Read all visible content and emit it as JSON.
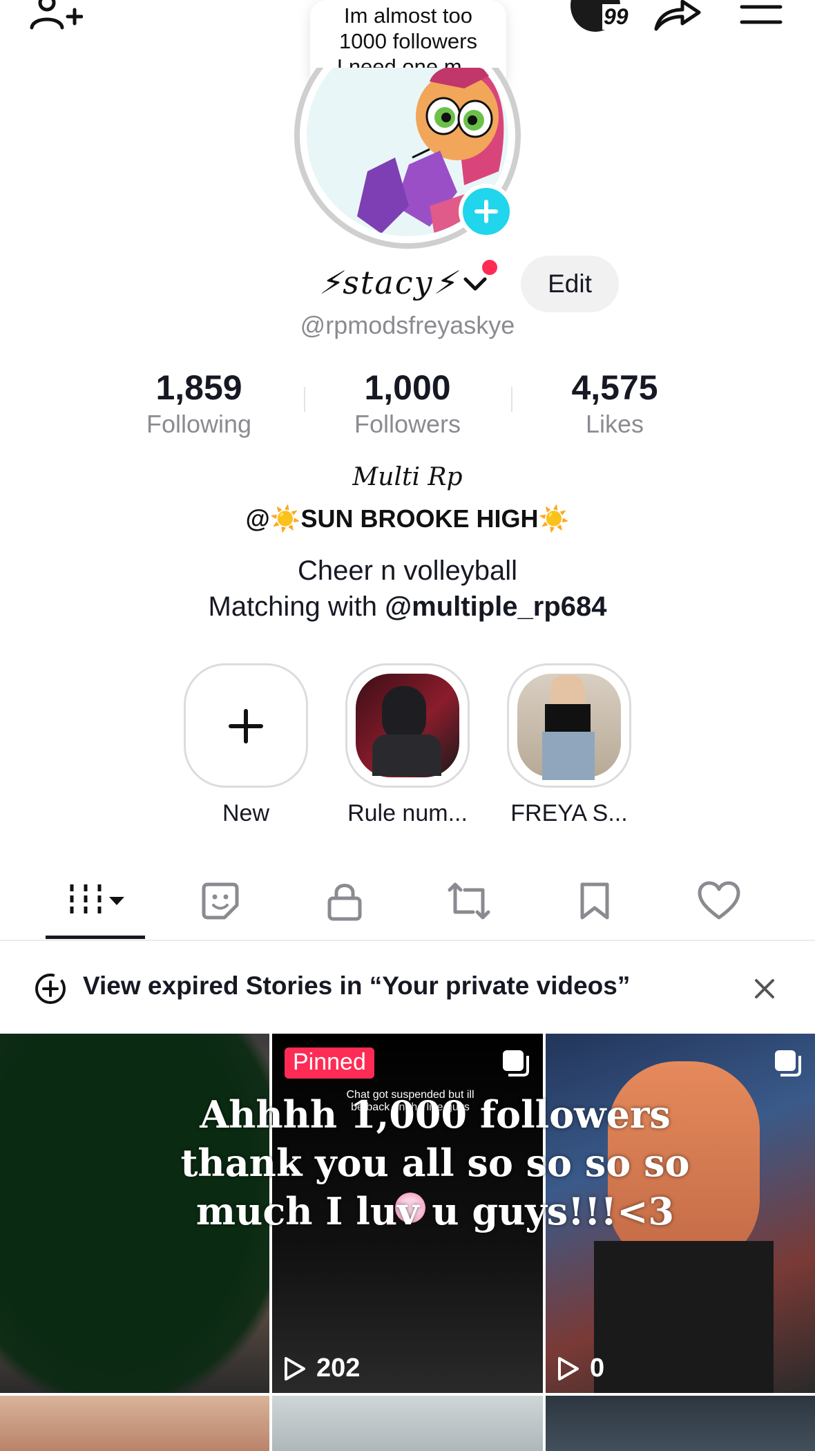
{
  "topbar": {
    "notification_count": "99"
  },
  "note": {
    "text_lines": [
      "Im almost too",
      "1000 followers",
      "I need one m..."
    ]
  },
  "profile": {
    "display_name": "⚡︎stacy⚡︎",
    "edit_label": "Edit",
    "handle": "@rpmodsfreyaskye"
  },
  "stats": {
    "following": {
      "value": "1,859",
      "label": "Following"
    },
    "followers": {
      "value": "1,000",
      "label": "Followers"
    },
    "likes": {
      "value": "4,575",
      "label": "Likes"
    }
  },
  "bio": {
    "line1": "Multi Rp",
    "line2": "@☀️SUN BROOKE HIGH☀️",
    "line3": "Cheer n volleyball",
    "line4_prefix": "Matching with ",
    "line4_mention": "@multiple_rp684"
  },
  "stories": [
    {
      "label": "New"
    },
    {
      "label": "Rule num..."
    },
    {
      "label": "FREYA S..."
    }
  ],
  "banner": {
    "text": "View expired Stories in “Your private videos”"
  },
  "videos": [
    {
      "pinned": false,
      "views": ""
    },
    {
      "pinned": true,
      "pinned_label": "Pinned",
      "views": "202",
      "caption": "Chat got suspended but ill be back on the live guys"
    },
    {
      "pinned": false,
      "views": "0"
    }
  ],
  "overlay": {
    "text": "Ahhhh 1,000 followers thank you all so so so so much I luv u guys!!!<3"
  },
  "colors": {
    "accent": "#fe2c55",
    "plus_badge": "#20d5ec",
    "text_primary": "#161823",
    "text_secondary": "#8a8b91",
    "scribble": "#0a2a12"
  },
  "icons": [
    "add-friend-icon",
    "share-icon",
    "menu-icon",
    "plus-icon",
    "videos-grid-icon",
    "stickers-icon",
    "lock-icon",
    "repost-icon",
    "bookmark-icon",
    "heart-icon",
    "stories-icon",
    "close-icon",
    "play-icon",
    "multi-image-icon"
  ]
}
